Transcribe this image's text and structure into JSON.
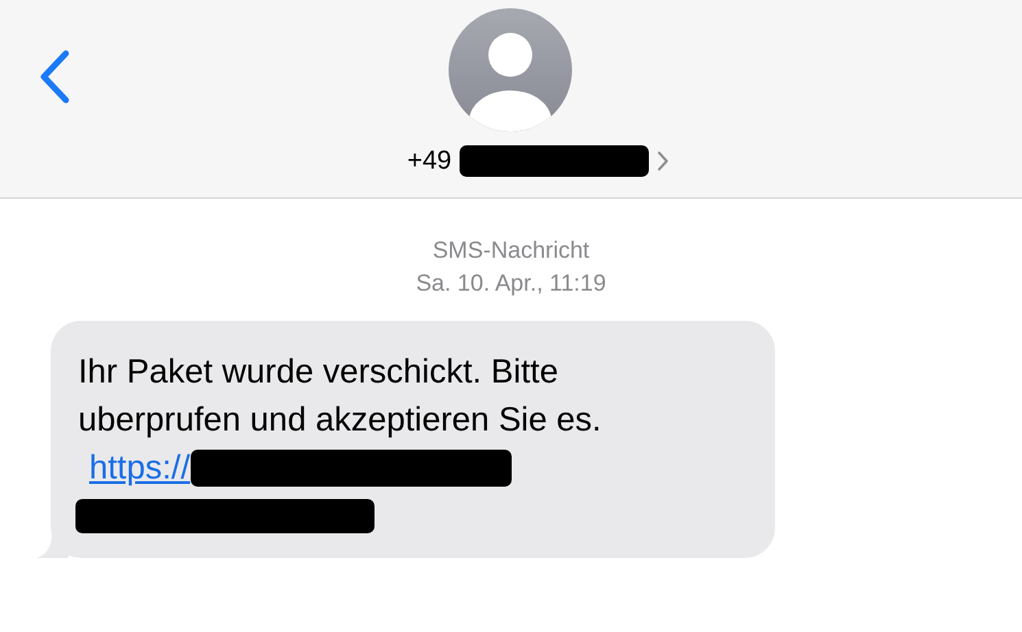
{
  "header": {
    "phone_prefix": "+49"
  },
  "message_info": {
    "service": "SMS-Nachricht",
    "timestamp": "Sa. 10. Apr., 11:19"
  },
  "messages": [
    {
      "text": "Ihr Paket wurde verschickt. Bitte uberprufen und akzeptieren Sie es.",
      "link": "https://"
    }
  ]
}
